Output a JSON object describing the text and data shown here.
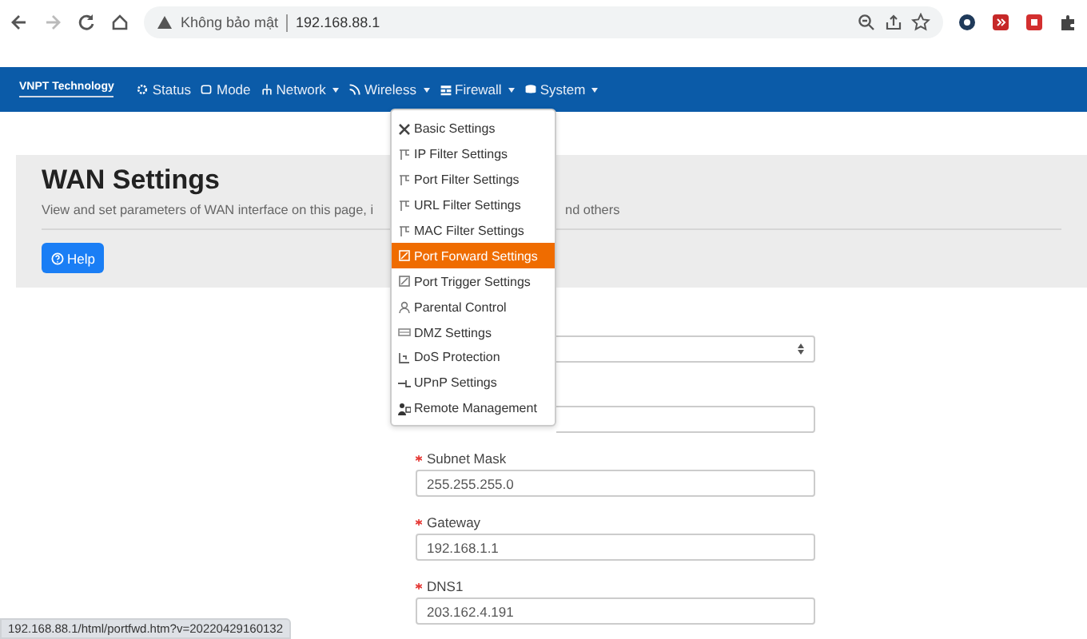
{
  "browser": {
    "security_label": "Không bảo mật",
    "url": "192.168.88.1"
  },
  "navbar": {
    "brand": "VNPT Technology",
    "items": [
      {
        "label": "Status",
        "dropdown": false
      },
      {
        "label": "Mode",
        "dropdown": false
      },
      {
        "label": "Network",
        "dropdown": true
      },
      {
        "label": "Wireless",
        "dropdown": true
      },
      {
        "label": "Firewall",
        "dropdown": true
      },
      {
        "label": "System",
        "dropdown": true
      }
    ]
  },
  "firewall_menu": [
    {
      "label": "Basic Settings",
      "selected": false
    },
    {
      "label": "IP Filter Settings",
      "selected": false
    },
    {
      "label": "Port Filter Settings",
      "selected": false
    },
    {
      "label": "URL Filter Settings",
      "selected": false
    },
    {
      "label": "MAC Filter Settings",
      "selected": false
    },
    {
      "label": "Port Forward Settings",
      "selected": true
    },
    {
      "label": "Port Trigger Settings",
      "selected": false
    },
    {
      "label": "Parental Control",
      "selected": false
    },
    {
      "label": "DMZ Settings",
      "selected": false
    },
    {
      "label": "DoS Protection",
      "selected": false
    },
    {
      "label": "UPnP Settings",
      "selected": false
    },
    {
      "label": "Remote Management",
      "selected": false
    }
  ],
  "header": {
    "title": "WAN Settings",
    "subtitle_start": "View and set parameters of WAN interface on this page, i",
    "subtitle_end": "nd others",
    "help_button": "Help"
  },
  "form": [
    {
      "kind": "select"
    },
    {
      "kind": "text"
    },
    {
      "kind": "text",
      "label": "Subnet Mask",
      "required": true,
      "value": "255.255.255.0"
    },
    {
      "kind": "text",
      "label": "Gateway",
      "required": true,
      "value": "192.168.1.1"
    },
    {
      "kind": "text",
      "label": "DNS1",
      "required": true,
      "value": "203.162.4.191"
    }
  ],
  "status_url": "192.168.88.1/html/portfwd.htm?v=20220429160132"
}
